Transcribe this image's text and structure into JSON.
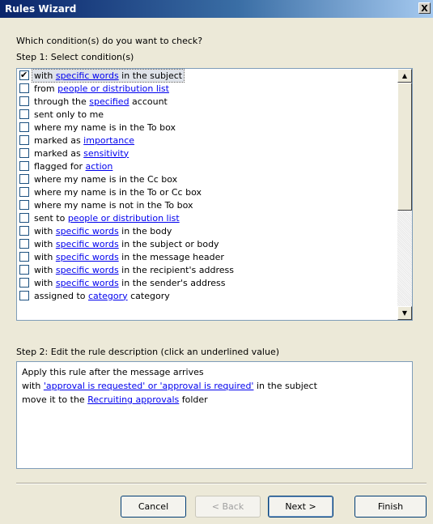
{
  "window": {
    "title": "Rules Wizard",
    "close_glyph": "X"
  },
  "question": "Which condition(s) do you want to check?",
  "step1": {
    "label": "Step 1: Select condition(s)",
    "items": [
      {
        "checked": true,
        "before": "with ",
        "link": "specific words",
        "after": " in the subject"
      },
      {
        "checked": false,
        "before": "from ",
        "link": "people or distribution list",
        "after": ""
      },
      {
        "checked": false,
        "before": "through the ",
        "link": "specified",
        "after": " account"
      },
      {
        "checked": false,
        "before": "sent only to me",
        "link": "",
        "after": ""
      },
      {
        "checked": false,
        "before": "where my name is in the To box",
        "link": "",
        "after": ""
      },
      {
        "checked": false,
        "before": "marked as ",
        "link": "importance",
        "after": ""
      },
      {
        "checked": false,
        "before": "marked as ",
        "link": "sensitivity",
        "after": ""
      },
      {
        "checked": false,
        "before": "flagged for ",
        "link": "action",
        "after": ""
      },
      {
        "checked": false,
        "before": "where my name is in the Cc box",
        "link": "",
        "after": ""
      },
      {
        "checked": false,
        "before": "where my name is in the To or Cc box",
        "link": "",
        "after": ""
      },
      {
        "checked": false,
        "before": "where my name is not in the To box",
        "link": "",
        "after": ""
      },
      {
        "checked": false,
        "before": "sent to ",
        "link": "people or distribution list",
        "after": ""
      },
      {
        "checked": false,
        "before": "with ",
        "link": "specific words",
        "after": " in the body"
      },
      {
        "checked": false,
        "before": "with ",
        "link": "specific words",
        "after": " in the subject or body"
      },
      {
        "checked": false,
        "before": "with ",
        "link": "specific words",
        "after": " in the message header"
      },
      {
        "checked": false,
        "before": "with ",
        "link": "specific words",
        "after": " in the recipient's address"
      },
      {
        "checked": false,
        "before": "with ",
        "link": "specific words",
        "after": " in the sender's address"
      },
      {
        "checked": false,
        "before": "assigned to ",
        "link": "category",
        "after": " category"
      }
    ]
  },
  "step2": {
    "label": "Step 2: Edit the rule description (click an underlined value)",
    "line1": "Apply this rule after the message arrives",
    "line2_before": "with ",
    "line2_link": "'approval is requested' or 'approval is required'",
    "line2_after": " in the subject",
    "line3_before": "move it to the ",
    "line3_link": "Recruiting approvals",
    "line3_after": " folder"
  },
  "buttons": {
    "cancel": "Cancel",
    "back": "< Back",
    "next": "Next >",
    "finish": "Finish"
  }
}
